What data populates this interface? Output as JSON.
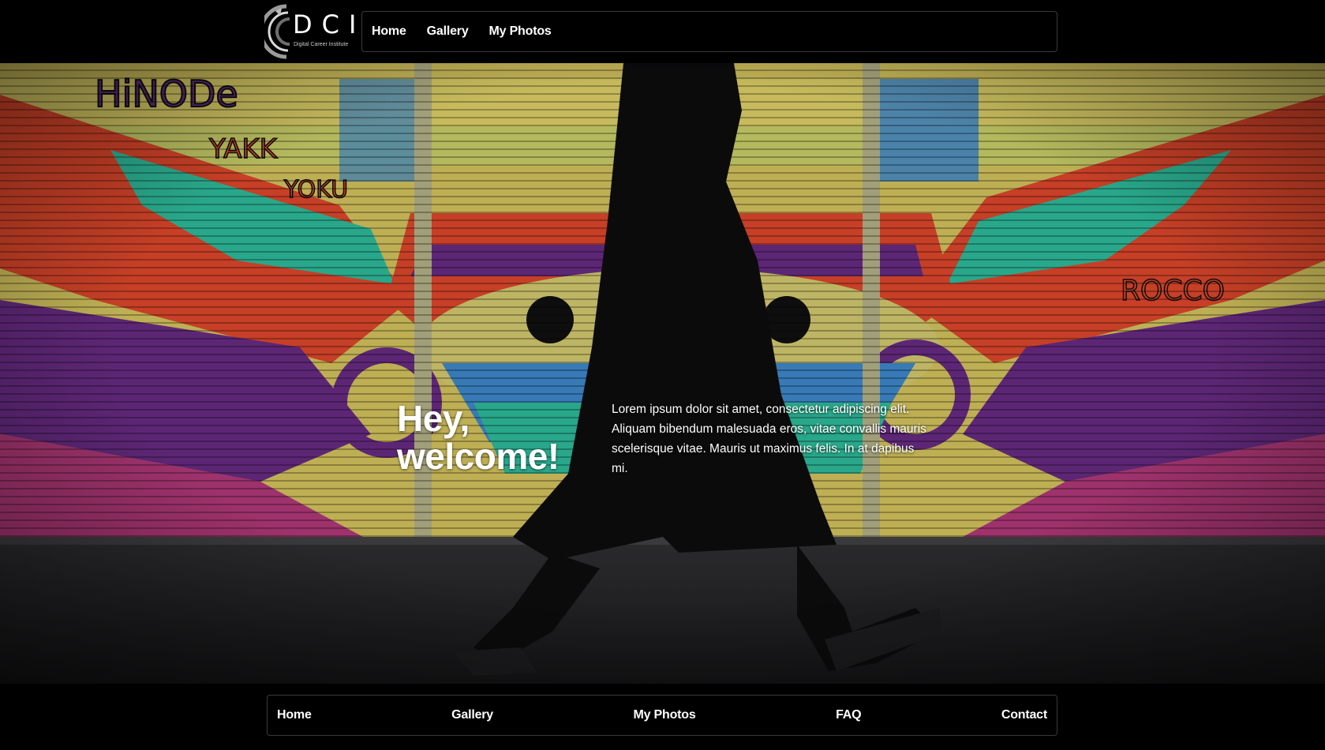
{
  "brand": {
    "name": "DCI",
    "tagline": "Digital Career Institute"
  },
  "top_nav": {
    "items": [
      {
        "label": "Home"
      },
      {
        "label": "Gallery"
      },
      {
        "label": "My Photos"
      }
    ]
  },
  "hero": {
    "title": "Hey, welcome!",
    "body": "Lorem ipsum dolor sit amet, consectetur adipiscing elit. Aliquam bibendum malesuada eros, vitae convallis mauris scelerisque vitae. Mauris ut maximus felis. In at dapibus mi.",
    "image_description_icon": "street-art-photo"
  },
  "footer_nav": {
    "items": [
      {
        "label": "Home"
      },
      {
        "label": "Gallery"
      },
      {
        "label": "My Photos"
      },
      {
        "label": "FAQ"
      },
      {
        "label": "Contact"
      }
    ]
  },
  "colors": {
    "background": "#000000",
    "text": "#ffffff",
    "nav_border": "#3a3a3a"
  }
}
